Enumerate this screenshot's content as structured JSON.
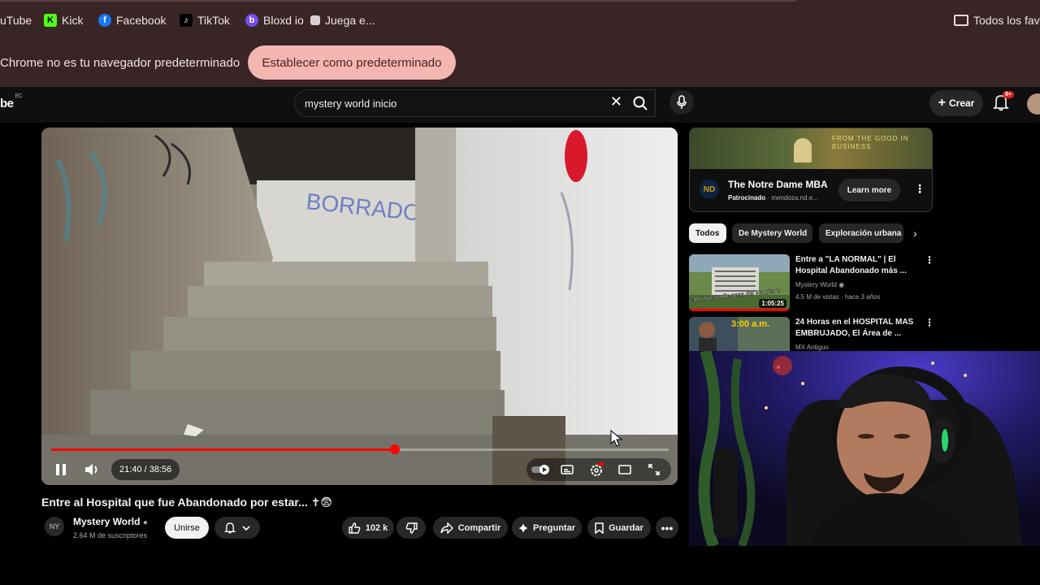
{
  "bookmarks": {
    "items": [
      {
        "label": "uTube",
        "icon": "youtube-icon"
      },
      {
        "label": "Kick",
        "icon": "kick-icon",
        "glyph": "K"
      },
      {
        "label": "Facebook",
        "icon": "facebook-icon",
        "glyph": "f"
      },
      {
        "label": "TikTok",
        "icon": "tiktok-icon",
        "glyph": "♪"
      },
      {
        "label": "Bloxd io",
        "icon": "bloxd-icon",
        "glyph": "b"
      },
      {
        "label": "Juega e...",
        "icon": "juega-icon"
      }
    ],
    "all_bookmarks_label": "Todos los fave"
  },
  "infobar": {
    "message": "Chrome no es tu navegador predeterminado",
    "button_label": "Establecer como predeterminado"
  },
  "header": {
    "logo_fragment": "be",
    "country": "EC",
    "search_query": "mystery world inicio",
    "create_label": "Crear",
    "notifications_badge": "9+"
  },
  "player": {
    "time": "21:40 / 38:56",
    "progress_fraction": 0.556,
    "scene_graffiti": "BORRADO"
  },
  "video": {
    "title": "Entre al Hospital que fue Abandonado por estar... ✝😨",
    "channel_name": "Mystery World",
    "channel_initials": "NY",
    "subscribers": "2.64 M de suscriptores",
    "join_label": "Unirse",
    "likes": "102 k",
    "share_label": "Compartir",
    "ask_label": "Preguntar",
    "save_label": "Guardar"
  },
  "ad": {
    "tagline": "FROM THE GOOD IN BUSINESS",
    "logo_initials": "ND",
    "title": "The Notre Dame MBA",
    "sponsored": "Patrocinado",
    "domain": "· mendoza.nd.e...",
    "cta": "Learn more"
  },
  "chips": [
    "Todos",
    "De Mystery World",
    "Exploración urbana"
  ],
  "recommendations": [
    {
      "title": "Entre a \"LA NORMAL\" | El Hospital Abandonado más ...",
      "channel": "Mystery World ◉",
      "meta": "4.5 M de vistas · hace 3 años",
      "duration": "1:05:25",
      "thumb_caption": "¿Porque nadie pasa del 5to piso?"
    },
    {
      "title": "24 Horas en el HOSPITAL MAS EMBRUJADO, El Área de ...",
      "channel": "MX Antiguo",
      "meta": "",
      "duration": "",
      "thumb_caption": "3:00 a.m."
    }
  ]
}
